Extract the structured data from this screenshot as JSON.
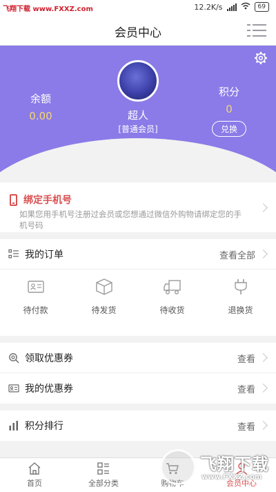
{
  "status_bar": {
    "watermark": "飞翔下载 www.FXXZ.com",
    "speed": "12.2K/s",
    "battery": "69"
  },
  "header": {
    "title": "会员中心"
  },
  "profile": {
    "balance_label": "余额",
    "balance_value": "0.00",
    "username": "超人",
    "level": "[普通会员]",
    "points_label": "积分",
    "points_value": "0",
    "exchange_label": "兑换"
  },
  "bind_phone": {
    "title": "绑定手机号",
    "description": "如果您用手机号注册过会员或您想通过微信外购物请绑定您的手机号码"
  },
  "orders": {
    "title": "我的订单",
    "view_all": "查看全部",
    "items": [
      {
        "label": "待付款",
        "icon": "wallet-card-icon"
      },
      {
        "label": "待发货",
        "icon": "package-box-icon"
      },
      {
        "label": "待收货",
        "icon": "delivery-truck-icon"
      },
      {
        "label": "退换货",
        "icon": "return-plug-icon"
      }
    ]
  },
  "coupons": {
    "claim_label": "领取优惠券",
    "claim_view": "查看",
    "mine_label": "我的优惠券",
    "mine_view": "查看"
  },
  "ranking": {
    "label": "积分排行",
    "view": "查看"
  },
  "bottom_nav": {
    "items": [
      {
        "label": "首页",
        "icon": "home-icon"
      },
      {
        "label": "全部分类",
        "icon": "category-icon"
      },
      {
        "label": "购物车",
        "icon": "cart-icon"
      },
      {
        "label": "会员中心",
        "icon": "member-icon"
      }
    ]
  },
  "watermark_logo": {
    "big": "飞翔下载",
    "small": "www.FXXZ.com"
  },
  "colors": {
    "header_purple": "#8a7be8",
    "accent_red": "#d94f4f",
    "value_yellow": "#f7d86b"
  }
}
